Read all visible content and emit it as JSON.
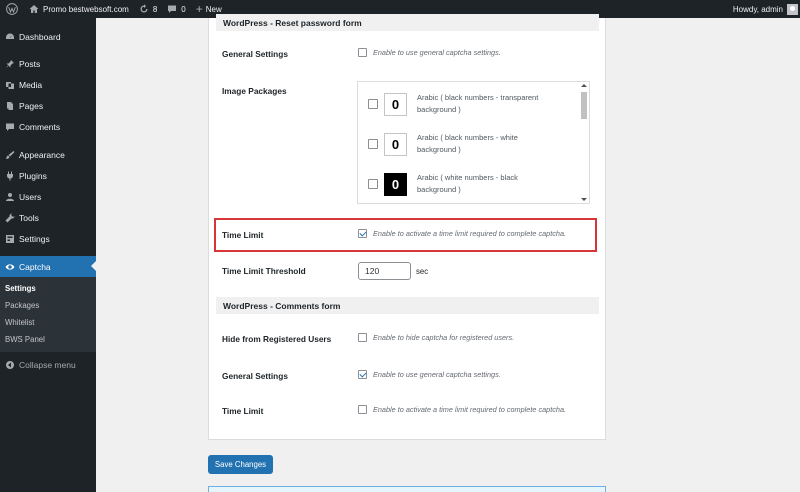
{
  "adminbar": {
    "site_name": "Promo bestwebsoft.com",
    "updates_count": "8",
    "comments_count": "0",
    "new_label": "New",
    "greeting": "Howdy, admin"
  },
  "sidebar": {
    "items": [
      {
        "label": "Dashboard",
        "icon": "dashboard-icon"
      },
      {
        "label": "Posts",
        "icon": "pin-icon"
      },
      {
        "label": "Media",
        "icon": "media-icon"
      },
      {
        "label": "Pages",
        "icon": "pages-icon"
      },
      {
        "label": "Comments",
        "icon": "comment-icon"
      },
      {
        "label": "Appearance",
        "icon": "brush-icon"
      },
      {
        "label": "Plugins",
        "icon": "plugin-icon"
      },
      {
        "label": "Users",
        "icon": "users-icon"
      },
      {
        "label": "Tools",
        "icon": "wrench-icon"
      },
      {
        "label": "Settings",
        "icon": "settings-icon"
      },
      {
        "label": "Captcha",
        "icon": "eye-icon"
      }
    ],
    "submenu": [
      "Settings",
      "Packages",
      "Whitelist",
      "BWS Panel"
    ],
    "collapse_label": "Collapse menu"
  },
  "reset_form": {
    "title": "WordPress - Reset password form",
    "general_settings_label": "General Settings",
    "general_settings_desc": "Enable to use general captcha settings.",
    "image_packages_label": "Image Packages",
    "packages": [
      {
        "digit": "0",
        "label": "Arabic ( black numbers - transparent background )"
      },
      {
        "digit": "0",
        "label": "Arabic ( black numbers - white background )"
      },
      {
        "digit": "0",
        "label": "Arabic ( white numbers - black background )"
      }
    ],
    "time_limit_label": "Time Limit",
    "time_limit_desc": "Enable to activate a time limit required to complete captcha.",
    "threshold_label": "Time Limit Threshold",
    "threshold_value": "120",
    "threshold_unit": "sec"
  },
  "comments_form": {
    "title": "WordPress - Comments form",
    "hide_label": "Hide from Registered Users",
    "hide_desc": "Enable to hide captcha for registered users.",
    "general_settings_label": "General Settings",
    "general_settings_desc": "Enable to use general captcha settings.",
    "time_limit_label": "Time Limit",
    "time_limit_desc": "Enable to activate a time limit required to complete captcha."
  },
  "save_label": "Save Changes",
  "colors": {
    "admin_bar": "#1d2327",
    "accent": "#2271b1",
    "highlight": "#d63638"
  }
}
